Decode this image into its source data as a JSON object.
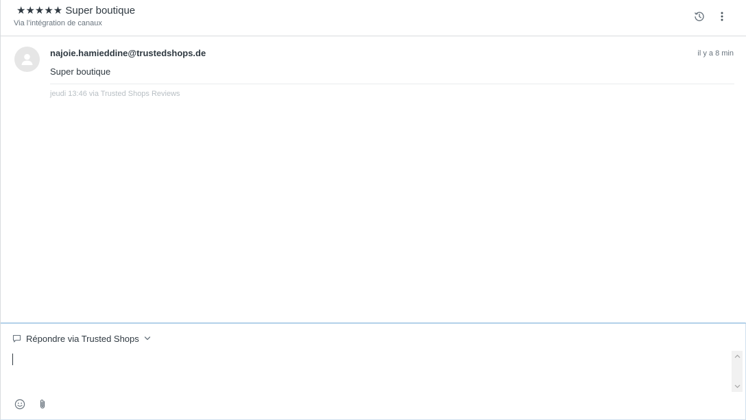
{
  "ticket": {
    "title": "★★★★★ Super boutique",
    "subtitle": "Via l’intégration de canaux"
  },
  "header_actions": {
    "history_icon": "history-icon",
    "more_icon": "more-vertical-icon"
  },
  "message": {
    "avatar_icon": "user-icon",
    "sender": "najoie.hamieddine@trustedshops.de",
    "time_ago": "il y a 8 min",
    "body": "Super boutique",
    "meta": "jeudi 13:46 via Trusted Shops Reviews"
  },
  "composer": {
    "channel_icon": "speech-bubble-icon",
    "channel_label": "Répondre via Trusted Shops",
    "chevron_icon": "chevron-down-icon",
    "reply_value": "",
    "emoji_icon": "emoji-icon",
    "attach_icon": "paperclip-icon"
  },
  "colors": {
    "text": "#2f3941",
    "muted": "#68737d",
    "meta": "#b8bfc4",
    "focus_border": "#6ea7d6",
    "divider": "#d8dcde"
  }
}
